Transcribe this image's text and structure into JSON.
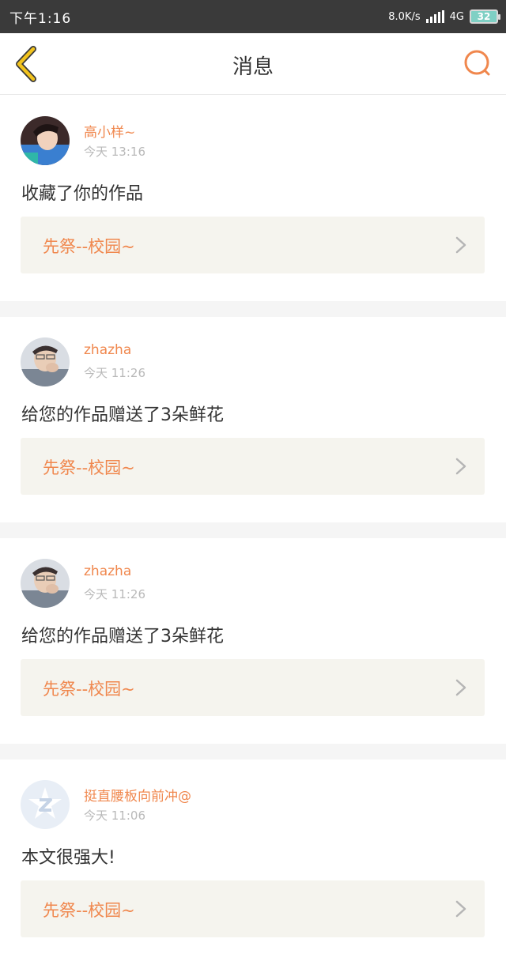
{
  "status": {
    "time": "下午1:16",
    "speed": "8.0K/s",
    "network": "4G",
    "battery": "32"
  },
  "header": {
    "title": "消息"
  },
  "messages": [
    {
      "user": "高小样~",
      "time": "今天 13:16",
      "text": "收藏了你的作品",
      "work": "先祭--校园~"
    },
    {
      "user": "zhazha",
      "time": "今天 11:26",
      "text": "给您的作品赠送了3朵鲜花",
      "work": "先祭--校园~"
    },
    {
      "user": "zhazha",
      "time": "今天 11:26",
      "text": "给您的作品赠送了3朵鲜花",
      "work": "先祭--校园~"
    },
    {
      "user": "挺直腰板向前冲@",
      "time": "今天 11:06",
      "text": "本文很强大!",
      "work": "先祭--校园~"
    }
  ],
  "colors": {
    "accent": "#f0874d",
    "back_arrow": "#f2c31d",
    "status_bar": "#3a3a3a",
    "work_box": "#f5f4ee"
  }
}
